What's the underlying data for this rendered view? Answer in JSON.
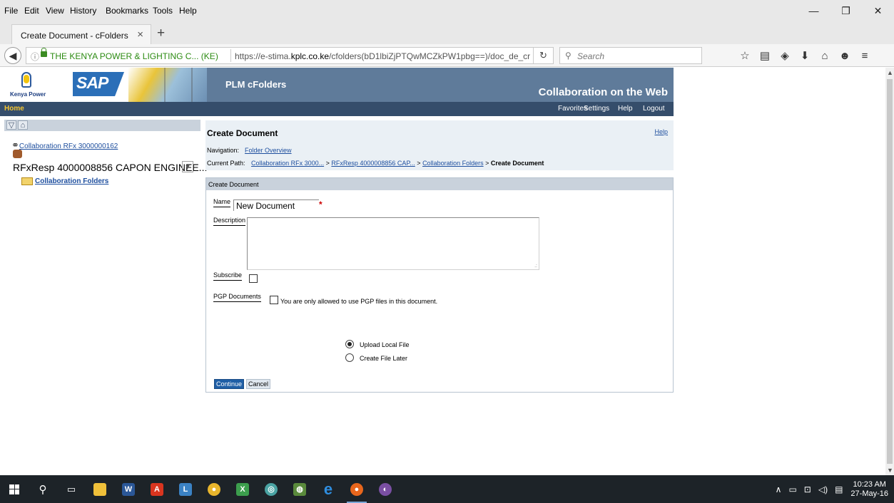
{
  "menubar": {
    "items": [
      {
        "label": "File",
        "accel": "F"
      },
      {
        "label": "Edit",
        "accel": "E"
      },
      {
        "label": "View",
        "accel": "V"
      },
      {
        "label": "History",
        "accel": "s"
      },
      {
        "label": "Bookmarks",
        "accel": "B"
      },
      {
        "label": "Tools",
        "accel": "T"
      },
      {
        "label": "Help",
        "accel": "H"
      }
    ]
  },
  "tab": {
    "title": "Create Document - cFolders",
    "close": "×",
    "newtab": "+"
  },
  "address": {
    "info_icon": "ⓘ",
    "identity": "THE KENYA POWER & LIGHTING C...  (KE)",
    "url_prefix": "https://e-stima.",
    "url_domain": "kplc.co.ke",
    "url_rest": "/cfolders(bD1lbiZjPTQwMCZkPW1pbg==)/doc_de_cr",
    "reload_icon": "↻"
  },
  "search": {
    "placeholder": "Search",
    "icon": "🔍"
  },
  "toolbar_icons": [
    "☆",
    "▤",
    "◈",
    "⬇",
    "⌂",
    "☻",
    "≡"
  ],
  "window_controls": {
    "minimize": "—",
    "restore": "❐",
    "close": "✕"
  },
  "banner": {
    "company": "Kenya Power",
    "sap": "SAP",
    "product": "PLM  cFolders",
    "tagline": "Collaboration on the Web"
  },
  "topnav": {
    "home": "Home",
    "links": [
      "Favorites",
      "Settings",
      "Help",
      "Logout"
    ]
  },
  "tree": {
    "rfx_link": "Collaboration RFx 3000000162",
    "response": "RFxResp 4000008856 CAPON ENGINEE...",
    "folders_link": "Collaboration Folders"
  },
  "main": {
    "title": "Create Document",
    "help": "Help",
    "navigation_label": "Navigation:",
    "navigation_link": "Folder Overview",
    "path_label": "Current Path:",
    "path": [
      "Collaboration RFx 3000...",
      "RFxResp 4000008856 CAP...",
      "Collaboration Folders"
    ],
    "path_current": "Create Document",
    "path_sep": " > "
  },
  "form": {
    "header": "Create Document",
    "name_label": "Name",
    "name_value": "New Document",
    "required_mark": "*",
    "description_label": "Description",
    "description_value": "",
    "subscribe_label": "Subscribe",
    "subscribe_checked": false,
    "pgp_label": "PGP Documents",
    "pgp_text": "You are only allowed to use PGP files in this document.",
    "pgp_checked": false,
    "radio_upload": "Upload Local File",
    "radio_later": "Create File Later",
    "selected_radio": "Upload Local File",
    "continue": "Continue",
    "cancel": "Cancel"
  },
  "taskbar": {
    "clock_time": "10:23 AM",
    "clock_date": "27-May-16",
    "apps": [
      "start",
      "search",
      "task-view",
      "file-explorer",
      "word",
      "acrobat",
      "app",
      "chrome",
      "excel",
      "app",
      "app",
      "edge",
      "firefox",
      "app"
    ]
  }
}
